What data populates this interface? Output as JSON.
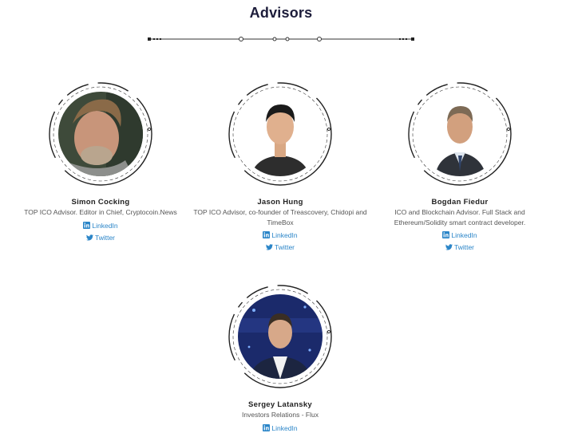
{
  "section": {
    "title": "Advisors"
  },
  "advisors": [
    {
      "name": "Simon Cocking",
      "role": "TOP ICO Advisor. Editor in Chief, Cryptocoin.News",
      "linkedin_label": "LinkedIn",
      "twitter_label": "Twitter"
    },
    {
      "name": "Jason Hung",
      "role": "TOP ICO Advisor, co-founder of Treascovery, Chidopi and TimeBox",
      "linkedin_label": "LinkedIn",
      "twitter_label": "Twitter"
    },
    {
      "name": "Bogdan Fiedur",
      "role": "ICO and Blockchain Advisor. Full Stack and Ethereum/Solidity smart contract developer.",
      "linkedin_label": "LinkedIn",
      "twitter_label": "Twitter"
    },
    {
      "name": "Sergey Latansky",
      "role": "Investors Relations - Flux",
      "linkedin_label": "LinkedIn"
    }
  ],
  "colors": {
    "title": "#1c1c3a",
    "link": "#2a85c8",
    "frame": "#222222"
  },
  "icons": [
    "linkedin-icon",
    "twitter-icon"
  ]
}
